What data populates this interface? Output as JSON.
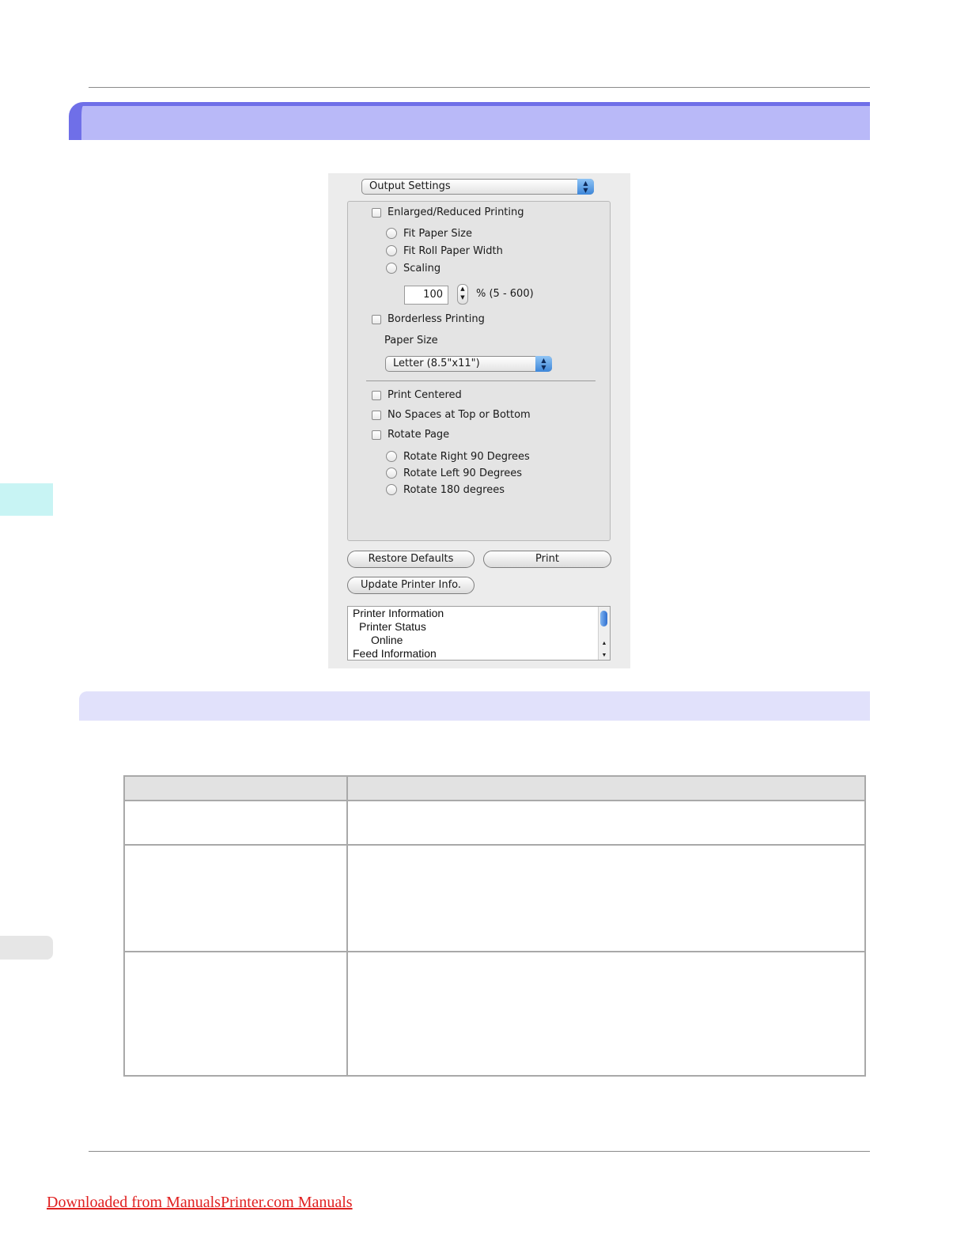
{
  "dialog": {
    "panel_select": "Output Settings",
    "enlarged_reduced_label": "Enlarged/Reduced Printing",
    "fit_paper_size_label": "Fit Paper Size",
    "fit_roll_paper_width_label": "Fit Roll Paper Width",
    "scaling_label": "Scaling",
    "scaling_value": "100",
    "scaling_range": "% (5 - 600)",
    "borderless_label": "Borderless Printing",
    "paper_size_label": "Paper Size",
    "paper_size_value": "Letter (8.5\"x11\")",
    "print_centered_label": "Print Centered",
    "no_spaces_label": "No Spaces at Top or Bottom",
    "rotate_page_label": "Rotate Page",
    "rotate_right_label": "Rotate Right 90 Degrees",
    "rotate_left_label": "Rotate Left 90 Degrees",
    "rotate_180_label": "Rotate 180 degrees",
    "restore_defaults_label": "Restore Defaults",
    "print_label": "Print",
    "update_printer_info_label": "Update Printer Info.",
    "info_lines": [
      "Printer Information",
      "Printer Status",
      "Online",
      "Feed Information"
    ]
  },
  "footer": {
    "download_link": "Downloaded from ManualsPrinter.com Manuals"
  }
}
